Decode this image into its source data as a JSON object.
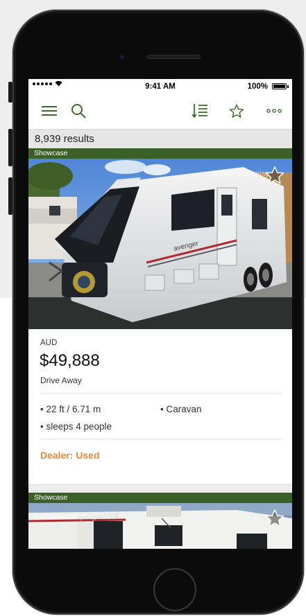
{
  "status_bar": {
    "time": "9:41 AM",
    "battery": "100%"
  },
  "nav": {
    "icons": [
      "menu-icon",
      "search-icon",
      "sort-icon",
      "star-icon",
      "more-icon"
    ]
  },
  "results": {
    "count_label": "8,939 results"
  },
  "listings": [
    {
      "badge": "Showcase",
      "watermark": "caravancamping",
      "currency": "AUD",
      "price": "$49,888",
      "price_note": "Drive Away",
      "specs": [
        "• 22 ft / 6.71 m",
        "• Caravan",
        "• sleeps 4 people"
      ],
      "dealer_status": "Dealer: Used"
    },
    {
      "badge": "Showcase",
      "watermark": "caravancampingsales"
    }
  ],
  "colors": {
    "brand_green": "#3b6128",
    "nav_green": "#3d6b2a",
    "dealer_orange": "#e8883a"
  }
}
